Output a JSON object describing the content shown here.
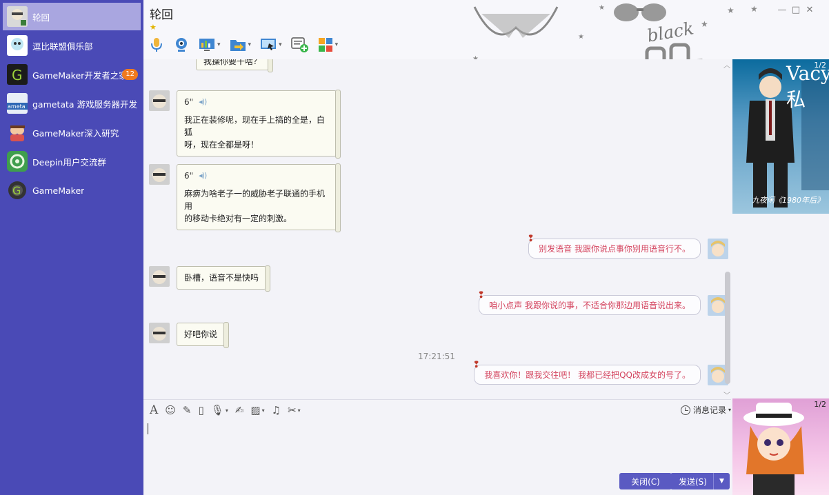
{
  "sidebar": {
    "items": [
      {
        "name": "轮回",
        "active": true
      },
      {
        "name": "逗比联盟俱乐部"
      },
      {
        "name": "GameMaker开发者之家",
        "badge": "12"
      },
      {
        "name": "gametata 游戏服务器开发"
      },
      {
        "name": "GameMaker深入研究"
      },
      {
        "name": "Deepin用户交流群"
      },
      {
        "name": "GameMaker"
      }
    ]
  },
  "header": {
    "title": "轮回",
    "star": "★",
    "decoration_text": "black"
  },
  "toolbar": {
    "icons": [
      "microphone-icon",
      "camera-icon",
      "screen-share-icon",
      "file-transfer-icon",
      "remote-desktop-icon",
      "new-chat-icon",
      "apps-icon"
    ]
  },
  "window_controls": {
    "minimize": "—",
    "maximize": "□",
    "close": "✕"
  },
  "messages": {
    "top_cut": "我操你要干啥？",
    "m1_duration": "6\"",
    "m1_text_line1": "我正在装修呢，现在手上搞的全是，白狐",
    "m1_text_line2": "呀，现在全都是呀！",
    "m2_duration": "6\"",
    "m2_text_line1": "麻痹为啥老子一的威胁老子联通的手机用",
    "m2_text_line2": "的移动卡绝对有一定的刺激。",
    "out1": "别发语音 我跟你说点事你别用语音行不。",
    "in3": "卧槽，语音不是快吗",
    "out2": "咱小点声 我跟你说的事，不适合你那边用语音说出来。",
    "in4": "好吧你说",
    "timestamp": "17:21:51",
    "out3": "我喜欢你！跟我交往吧！ 我都已经把QQ改成女的号了。"
  },
  "input": {
    "history_label": "消息记录",
    "close_button": "关闭(C)",
    "send_button": "发送(S)"
  },
  "right_panel": {
    "card1_pager": "1/2",
    "card1_title": "Vacy私",
    "card1_footer": "九夜闲《1980年后》",
    "card2_pager": "1/2"
  },
  "colors": {
    "sidebar_bg": "#4a4ab6",
    "sidebar_active": "#a9a6e0",
    "outgoing_text": "#d4455f",
    "button": "#5a5ac2"
  }
}
